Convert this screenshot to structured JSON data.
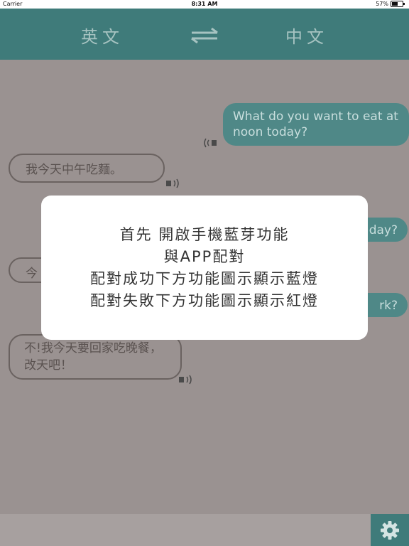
{
  "status_bar": {
    "carrier": "Carrier",
    "time": "8:31 AM",
    "battery": "57%",
    "battery_level": 0.57
  },
  "header": {
    "source_lang": "英文",
    "target_lang": "中文"
  },
  "messages": [
    {
      "side": "out",
      "text": "What do you want to eat at noon today?"
    },
    {
      "side": "in",
      "text": "我今天中午吃麵。"
    },
    {
      "side": "out",
      "text": "day?"
    },
    {
      "side": "in",
      "text": "今"
    },
    {
      "side": "out",
      "text": "rk?"
    },
    {
      "side": "in",
      "text": "不!我今天要回家吃晚餐，改天吧！"
    }
  ],
  "modal": {
    "lines": [
      "首先 開啟手機藍芽功能",
      "與APP配對",
      "配對成功下方功能圖示顯示藍燈",
      "配對失敗下方功能圖示顯示紅燈"
    ]
  },
  "colors": {
    "header": "#3f7b7a",
    "bubble_out": "#4f8887",
    "overlay": "#9a9291"
  }
}
